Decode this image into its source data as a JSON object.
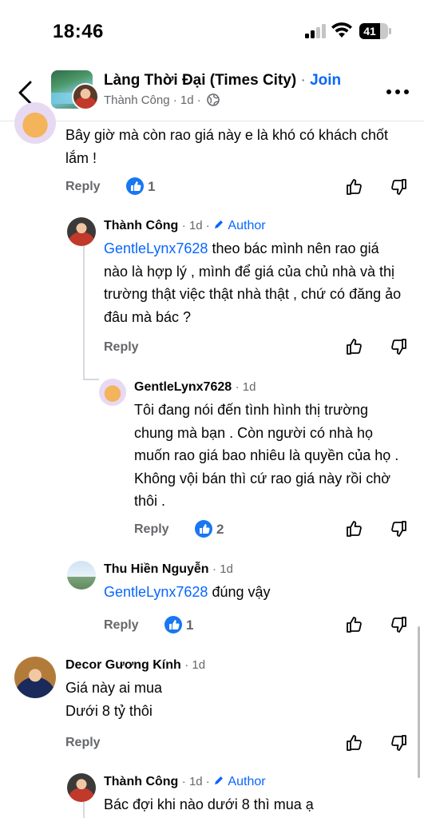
{
  "status_bar": {
    "time": "18:46",
    "battery": "41"
  },
  "header": {
    "group_name": "Làng Thời Đại (Times City)",
    "separator": "·",
    "join_label": "Join",
    "poster": "Thành Công",
    "post_time": "1d"
  },
  "comments": [
    {
      "text": "Bây giờ mà còn rao giá này e là khó có khách chốt lắm !",
      "reply_label": "Reply",
      "likes": "1",
      "avatar_icon": "lynx-cat-avatar"
    },
    {
      "name": "Thành Công",
      "time": "1d",
      "author_label": "Author",
      "mention": "GentleLynx7628",
      "text": " theo bác mình nên rao giá nào là hợp lý , mình để giá của chủ nhà và thị trường thật việc thật nhà thật , chứ có đăng ảo đâu mà bác ?",
      "reply_label": "Reply"
    },
    {
      "name": "GentleLynx7628",
      "time": "1d",
      "text": "Tôi đang nói đến tình hình thị trường chung mà bạn . Còn người có nhà họ muốn rao giá bao nhiêu là quyền của họ . Không vội bán thì cứ rao giá này rồi chờ thôi .",
      "reply_label": "Reply",
      "likes": "2"
    },
    {
      "name": "Thu Hiền Nguyễn",
      "time": "1d",
      "mention": "GentleLynx7628",
      "text": " đúng vậy",
      "reply_label": "Reply",
      "likes": "1"
    },
    {
      "name": "Decor Gương Kính",
      "time": "1d",
      "line1": "Giá này ai mua",
      "line2": "Dưới 8 tỷ thôi",
      "reply_label": "Reply"
    },
    {
      "name": "Thành Công",
      "time": "1d",
      "author_label": "Author",
      "text": "Bác đợi khi nào dưới 8 thì mua ạ"
    }
  ],
  "colors": {
    "accent": "#0866ff",
    "like_blue": "#1877f2",
    "muted": "#65676b"
  }
}
